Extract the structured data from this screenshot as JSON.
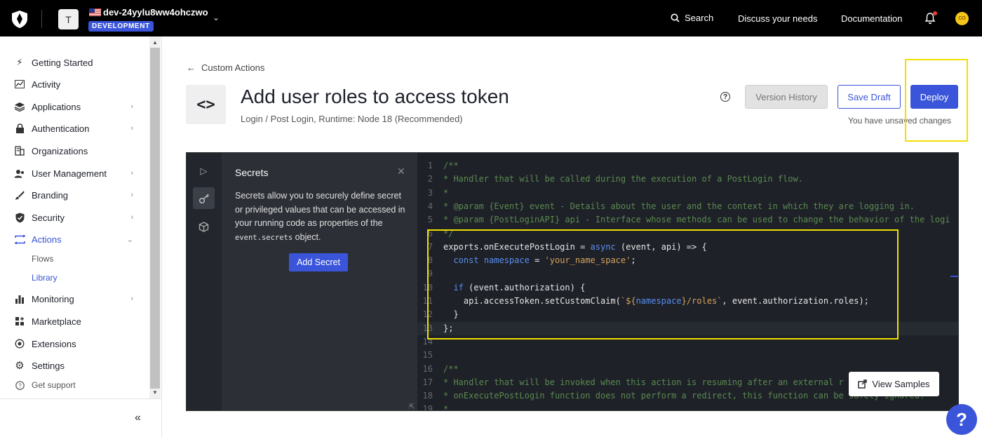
{
  "topbar": {
    "tenant_initial": "T",
    "tenant_name": "dev-24yylu8ww4ohczwo",
    "environment": "DEVELOPMENT",
    "search_label": "Search",
    "discuss_label": "Discuss your needs",
    "docs_label": "Documentation",
    "user_initials": "CO"
  },
  "sidebar": {
    "items": [
      {
        "label": "Getting Started",
        "icon": "lightning-icon"
      },
      {
        "label": "Activity",
        "icon": "activity-chart-icon"
      },
      {
        "label": "Applications",
        "icon": "layers-icon"
      },
      {
        "label": "Authentication",
        "icon": "lock-icon"
      },
      {
        "label": "Organizations",
        "icon": "building-icon"
      },
      {
        "label": "User Management",
        "icon": "users-icon"
      },
      {
        "label": "Branding",
        "icon": "brush-icon"
      },
      {
        "label": "Security",
        "icon": "shield-icon"
      },
      {
        "label": "Actions",
        "icon": "actions-icon"
      },
      {
        "label": "Monitoring",
        "icon": "bar-chart-icon"
      },
      {
        "label": "Marketplace",
        "icon": "grid-plus-icon"
      },
      {
        "label": "Extensions",
        "icon": "extensions-icon"
      },
      {
        "label": "Settings",
        "icon": "gear-icon"
      }
    ],
    "sub_items": {
      "flows": "Flows",
      "library": "Library"
    },
    "get_support": "Get support"
  },
  "header": {
    "back_label": "Custom Actions",
    "title": "Add user roles to access token",
    "subtitle": "Login / Post Login, Runtime: Node 18 (Recommended)",
    "version_history": "Version History",
    "save_draft": "Save Draft",
    "deploy": "Deploy",
    "unsaved": "You have unsaved changes"
  },
  "secrets": {
    "title": "Secrets",
    "desc_before": "Secrets allow you to securely define secret or privileged values that can be accessed in your running code as properties of the ",
    "desc_code": "event.secrets",
    "desc_after": " object.",
    "add_label": "Add Secret"
  },
  "code": {
    "lines": [
      {
        "n": "1",
        "t": "/**"
      },
      {
        "n": "2",
        "t": "* Handler that will be called during the execution of a PostLogin flow."
      },
      {
        "n": "3",
        "t": "*"
      },
      {
        "n": "4",
        "t": "* @param {Event} event - Details about the user and the context in which they are logging in."
      },
      {
        "n": "5",
        "t": "* @param {PostLoginAPI} api - Interface whose methods can be used to change the behavior of the logi"
      },
      {
        "n": "6",
        "t": "*/"
      },
      {
        "n": "7",
        "t": "exports.onExecutePostLogin = async (event, api) => {"
      },
      {
        "n": "8",
        "t": "  const namespace = 'your_name_space';"
      },
      {
        "n": "9",
        "t": ""
      },
      {
        "n": "10",
        "t": "  if (event.authorization) {"
      },
      {
        "n": "11",
        "t": "    api.accessToken.setCustomClaim(`${namespace}/roles`, event.authorization.roles);"
      },
      {
        "n": "12",
        "t": "  }"
      },
      {
        "n": "13",
        "t": "};"
      },
      {
        "n": "14",
        "t": ""
      },
      {
        "n": "15",
        "t": ""
      },
      {
        "n": "16",
        "t": "/**"
      },
      {
        "n": "17",
        "t": "* Handler that will be invoked when this action is resuming after an external r"
      },
      {
        "n": "18",
        "t": "* onExecutePostLogin function does not perform a redirect, this function can be safely ignored."
      },
      {
        "n": "19",
        "t": "*"
      }
    ]
  },
  "view_samples": "View Samples",
  "colors": {
    "accent": "#3a55d9",
    "highlight": "#f0e000"
  }
}
